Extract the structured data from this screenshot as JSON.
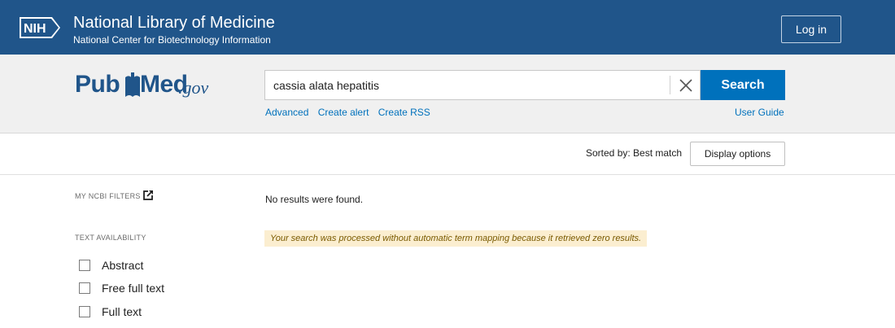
{
  "header": {
    "nih_logo_text": "NIH",
    "title": "National Library of Medicine",
    "subtitle": "National Center for Biotechnology Information",
    "login_label": "Log in",
    "bg_color": "#20558a"
  },
  "search": {
    "logo_pub": "Pub",
    "logo_med": "Med",
    "logo_gov": ".gov",
    "query": "cassia alata hepatitis",
    "button_label": "Search",
    "links": [
      "Advanced",
      "Create alert",
      "Create RSS"
    ],
    "user_guide": "User Guide",
    "button_color": "#0071bc"
  },
  "sort": {
    "sorted_by": "Sorted by: Best match",
    "display_options": "Display options"
  },
  "sidebar": {
    "my_ncbi_filters": "MY NCBI FILTERS",
    "text_availability": "TEXT AVAILABILITY",
    "filters": [
      "Abstract",
      "Free full text",
      "Full text"
    ]
  },
  "results": {
    "no_results": "No results were found.",
    "notice": "Your search was processed without automatic term mapping because it retrieved zero results."
  }
}
